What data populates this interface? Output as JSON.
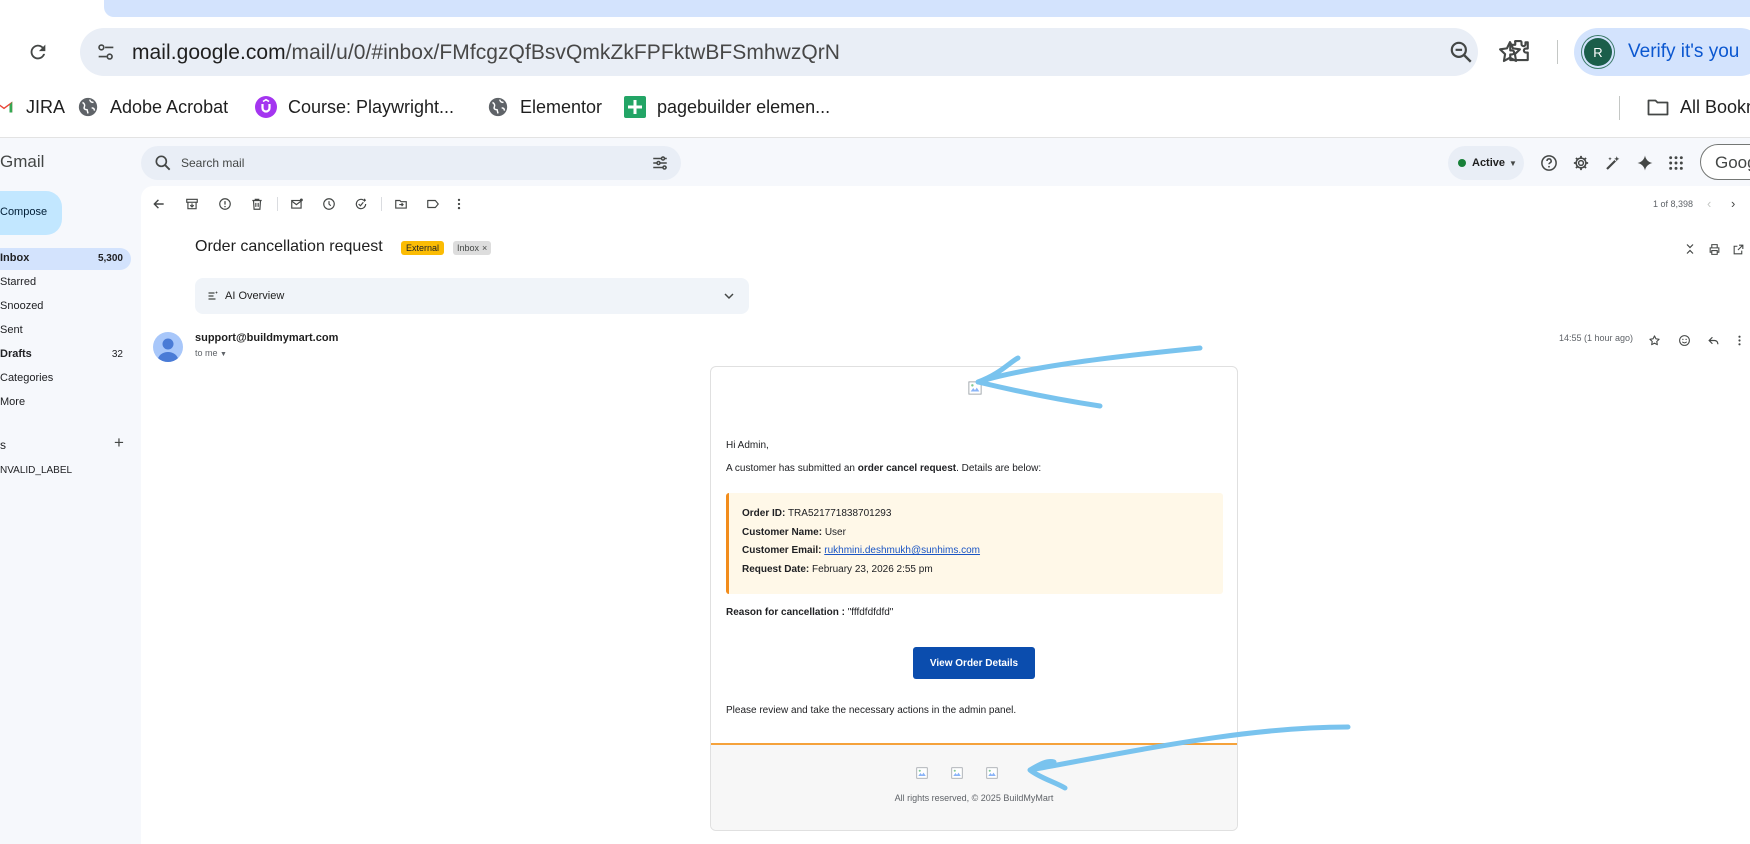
{
  "browser": {
    "url_host": "mail.google.com",
    "url_path": "/mail/u/0/#inbox/FMfcgzQfBsvQmkZkFPFktwBFSmhwzQrN",
    "profile_initial": "R",
    "profile_label": "Verify it's you",
    "bookmarks": [
      {
        "label": "JIRA",
        "icon": "gmail-m-icon"
      },
      {
        "label": "Adobe Acrobat",
        "icon": "globe-icon"
      },
      {
        "label": "Course: Playwright...",
        "icon": "udemy-icon"
      },
      {
        "label": "Elementor",
        "icon": "globe-icon"
      },
      {
        "label": "pagebuilder elemen...",
        "icon": "sheets-icon"
      }
    ],
    "all_bookmarks_label": "All Bookm"
  },
  "gmail": {
    "logo": "Gmail",
    "search_placeholder": "Search mail",
    "status_label": "Active",
    "account_chip": "Goog",
    "compose_label": "Compose",
    "nav": [
      {
        "label": "Inbox",
        "count": "5,300"
      },
      {
        "label": "Starred",
        "count": ""
      },
      {
        "label": "Snoozed",
        "count": ""
      },
      {
        "label": "Sent",
        "count": ""
      },
      {
        "label": "Drafts",
        "count": "32"
      },
      {
        "label": "Categories",
        "count": ""
      },
      {
        "label": "More",
        "count": ""
      }
    ],
    "labels_header": "s",
    "labels": [
      "NVALID_LABEL"
    ],
    "pager": "1 of 8,398"
  },
  "message": {
    "subject": "Order cancellation request",
    "tag_external": "External",
    "tag_inbox": "Inbox",
    "ai_overview": "AI Overview",
    "sender": "support@buildmymart.com",
    "to": "to me",
    "time": "14:55 (1 hour ago)"
  },
  "email_body": {
    "greeting": "Hi Admin,",
    "intro_before": "A customer has submitted an ",
    "intro_bold": "order cancel request",
    "intro_after": ". Details are below:",
    "details": {
      "order_id_label": "Order ID:",
      "order_id": "TRA521771838701293",
      "customer_name_label": "Customer Name:",
      "customer_name": "User",
      "customer_email_label": "Customer Email:",
      "customer_email": "rukhmini.deshmukh@sunhims.com",
      "request_date_label": "Request Date:",
      "request_date": "February 23, 2026 2:55 pm"
    },
    "reason_label": "Reason for cancellation :",
    "reason": "\"fffdfdfdfd\"",
    "button_label": "View Order Details",
    "review_text": "Please review and take the necessary actions in the admin panel.",
    "copyright": "All rights reserved, © 2025 BuildMyMart"
  },
  "colors": {
    "accent": "#0b57d0",
    "tag_external": "#fbbc04",
    "order_button": "#0b4dae",
    "details_border": "#f28c1b",
    "annotation": "#79c3ee"
  }
}
